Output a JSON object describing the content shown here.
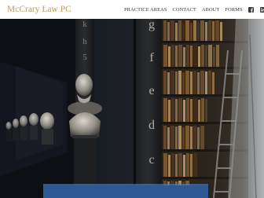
{
  "brand": {
    "name": "McCrary Law PC"
  },
  "nav": {
    "links": [
      {
        "label": "PRACTICE AREAS"
      },
      {
        "label": "CONTACT"
      },
      {
        "label": "ABOUT"
      },
      {
        "label": "FORMS"
      }
    ],
    "social": [
      {
        "icon": "facebook-icon"
      },
      {
        "icon": "linkedin-icon"
      }
    ]
  },
  "hero": {
    "right_column_letters": [
      "g",
      "f",
      "e",
      "d",
      "c"
    ],
    "left_column_letters": [
      "k",
      "h",
      "5"
    ]
  },
  "colors": {
    "brand_gold": "#b9a05e",
    "nav_text": "#333333",
    "strip_blue": "#2d5891"
  }
}
